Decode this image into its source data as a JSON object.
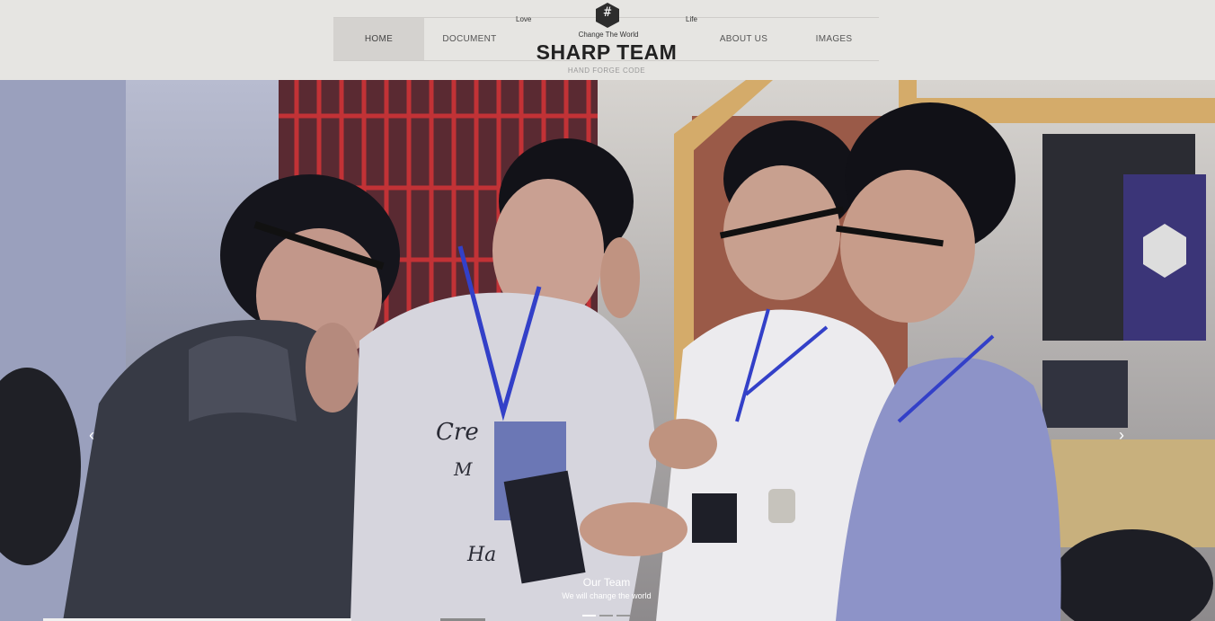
{
  "nav": {
    "items": [
      {
        "label": "HOME",
        "active": true
      },
      {
        "label": "DOCUMENT",
        "active": false
      },
      {
        "label": "ABOUT US",
        "active": false
      },
      {
        "label": "IMAGES",
        "active": false
      }
    ]
  },
  "logo": {
    "symbol": "#",
    "left_word": "Love",
    "top_word": "Change The World",
    "right_word": "Life",
    "brand": "SHARP TEAM",
    "slogan": "HAND FORGE CODE"
  },
  "carousel": {
    "prev_icon": "chevron-left-icon",
    "next_icon": "chevron-right-icon",
    "prev_glyph": "‹",
    "next_glyph": "›",
    "caption_title": "Our Team",
    "caption_subtitle": "We will change the world",
    "slide_count": 3,
    "active_slide": 1
  },
  "colors": {
    "header_bg": "#e6e5e2",
    "active_nav_bg": "#d4d2cf",
    "brand_text": "#222222",
    "lanyard": "#3340c8"
  }
}
